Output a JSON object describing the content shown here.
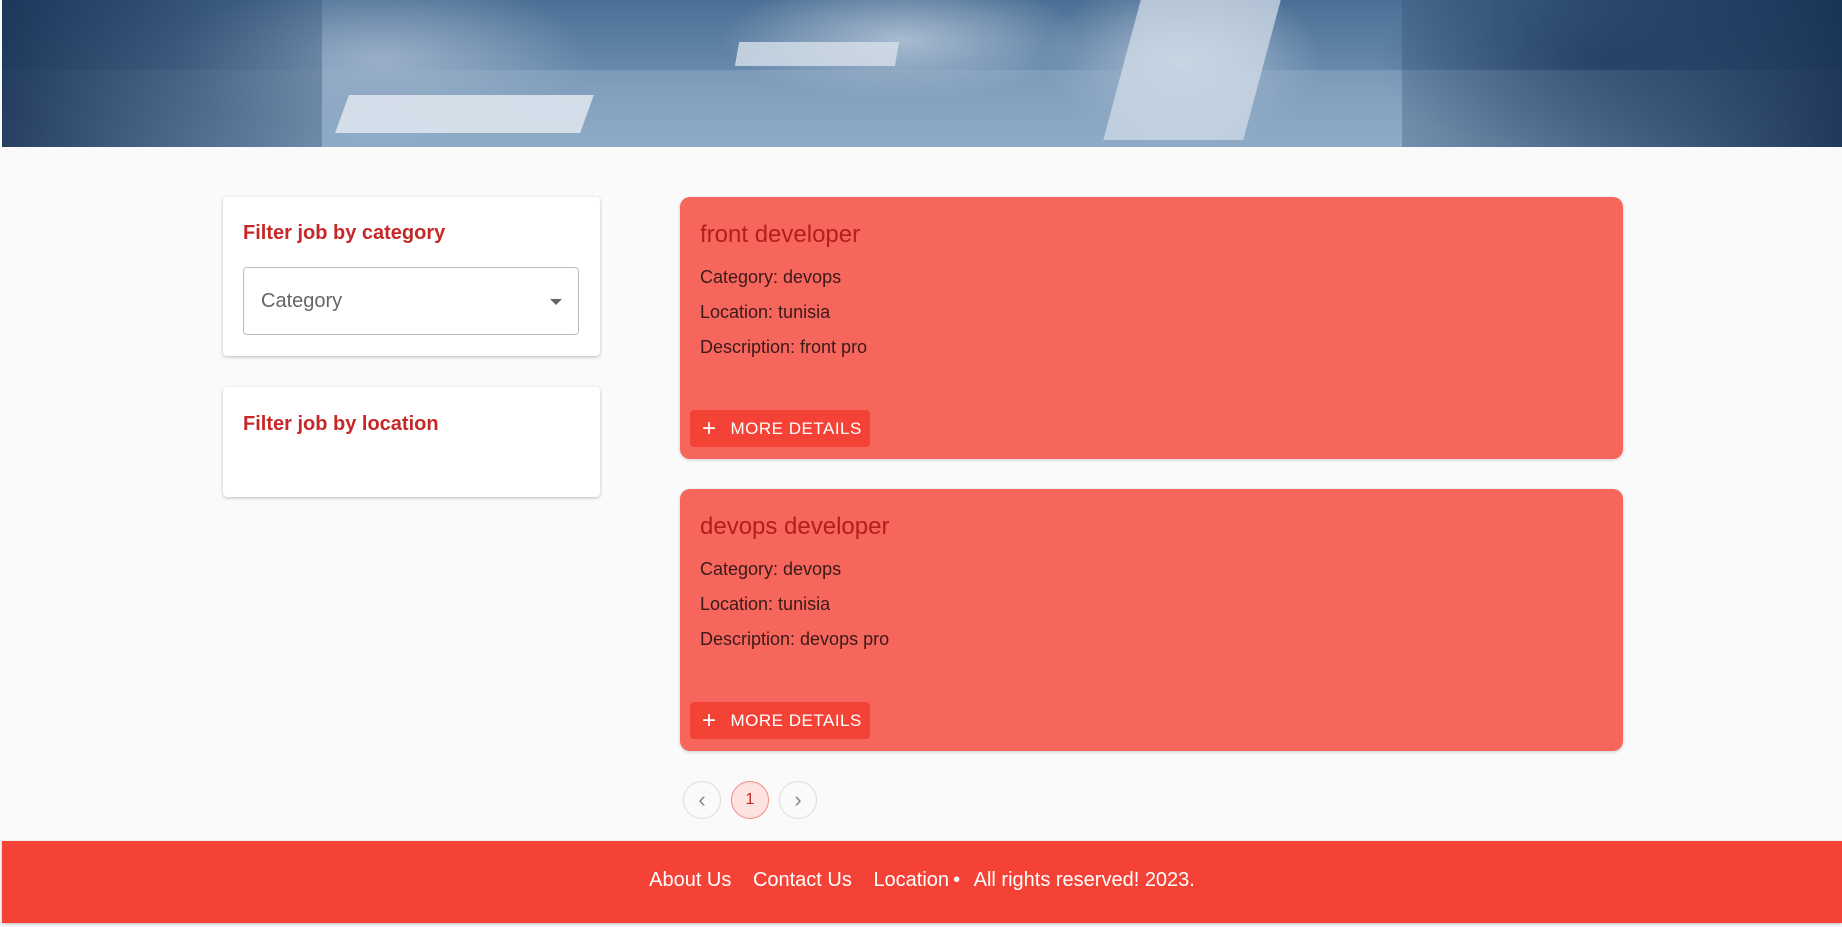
{
  "filters": {
    "category_title": "Filter job by category",
    "category_placeholder": "Category",
    "location_title": "Filter job by location"
  },
  "jobs": [
    {
      "title": "front developer",
      "category": "Category: devops",
      "location": "Location: tunisia",
      "description": "Description: front pro",
      "button_label": "MORE DETAILS"
    },
    {
      "title": "devops developer",
      "category": "Category: devops",
      "location": "Location: tunisia",
      "description": "Description: devops pro",
      "button_label": "MORE DETAILS"
    }
  ],
  "pagination": {
    "prev_icon": "‹",
    "current_page": "1",
    "next_icon": "›"
  },
  "footer": {
    "about": "About Us",
    "contact": "Contact Us",
    "location": "Location",
    "separator": "•",
    "rights": "All rights reserved! 2023."
  },
  "colors": {
    "accent": "#f44336",
    "card": "#f6665c",
    "title": "#c62828"
  }
}
